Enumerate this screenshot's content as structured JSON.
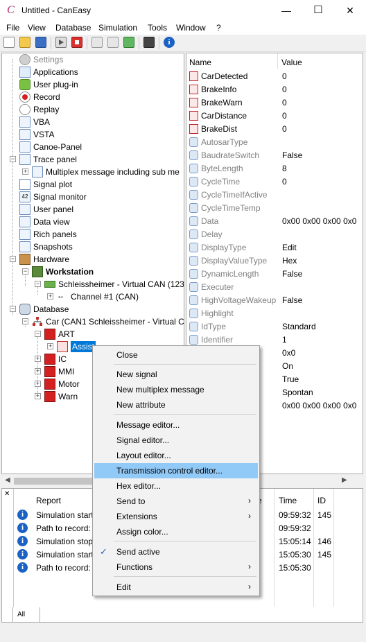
{
  "window": {
    "title": "Untitled - CanEasy",
    "minimize": "—",
    "maximize": "☐",
    "close": "✕"
  },
  "menubar": [
    "File",
    "View",
    "Database",
    "Simulation",
    "Tools",
    "Window",
    "?"
  ],
  "tree": {
    "settings": "Settings",
    "applications": "Applications",
    "user_plugin": "User plug-in",
    "record": "Record",
    "replay": "Replay",
    "vba": "VBA",
    "vsta": "VSTA",
    "canoe_panel": "Canoe-Panel",
    "trace_panel": "Trace panel",
    "multiplex": "Multiplex message including sub me",
    "signal_plot": "Signal plot",
    "signal_monitor": "Signal monitor",
    "user_panel": "User panel",
    "data_view": "Data view",
    "rich_panels": "Rich panels",
    "snapshots": "Snapshots",
    "hardware": "Hardware",
    "workstation": "Workstation",
    "virtual_can": "Schleissheimer - Virtual CAN (123",
    "channel": "Channel #1 (CAN)",
    "database": "Database",
    "car": "Car (CAN1 Schleissheimer - Virtual C",
    "art": "ART",
    "assist": "Assist",
    "ic": "IC",
    "mmi": "MMI",
    "motor": "Motor",
    "warn": "Warn"
  },
  "properties": {
    "header_name": "Name",
    "header_value": "Value",
    "rows": [
      {
        "name": "CarDetected",
        "value": "0",
        "kind": "signal"
      },
      {
        "name": "BrakeInfo",
        "value": "0",
        "kind": "signal"
      },
      {
        "name": "BrakeWarn",
        "value": "0",
        "kind": "signal"
      },
      {
        "name": "CarDistance",
        "value": "0",
        "kind": "signal"
      },
      {
        "name": "BrakeDist",
        "value": "0",
        "kind": "signal"
      },
      {
        "name": "AutosarType",
        "value": "",
        "kind": "attr-gray"
      },
      {
        "name": "BaudrateSwitch",
        "value": "False",
        "kind": "attr"
      },
      {
        "name": "ByteLength",
        "value": "8",
        "kind": "attr"
      },
      {
        "name": "CycleTime",
        "value": "0",
        "kind": "attr"
      },
      {
        "name": "CycleTimeIfActive",
        "value": "",
        "kind": "attr-gray"
      },
      {
        "name": "CycleTimeTemp",
        "value": "",
        "kind": "attr-gray"
      },
      {
        "name": "Data",
        "value": "0x00 0x00 0x00 0x0",
        "kind": "attr"
      },
      {
        "name": "Delay",
        "value": "",
        "kind": "attr-gray"
      },
      {
        "name": "DisplayType",
        "value": "Edit",
        "kind": "attr"
      },
      {
        "name": "DisplayValueType",
        "value": "Hex",
        "kind": "attr"
      },
      {
        "name": "DynamicLength",
        "value": "False",
        "kind": "attr"
      },
      {
        "name": "Executer",
        "value": "",
        "kind": "attr-gray"
      },
      {
        "name": "HighVoltageWakeup",
        "value": "False",
        "kind": "attr"
      },
      {
        "name": "Highlight",
        "value": "",
        "kind": "attr-gray"
      },
      {
        "name": "IdType",
        "value": "Standard",
        "kind": "attr"
      },
      {
        "name": "Identifier",
        "value": "1",
        "kind": "attr"
      },
      {
        "name": "",
        "value": "0x0",
        "kind": "hidden"
      },
      {
        "name": "e",
        "value": "On",
        "kind": "partial"
      },
      {
        "name": "ive",
        "value": "True",
        "kind": "partial"
      },
      {
        "name": "de",
        "value": "Spontan",
        "kind": "partial"
      },
      {
        "name": "",
        "value": "0x00 0x00 0x00 0x0",
        "kind": "hidden"
      }
    ]
  },
  "log": {
    "headers": {
      "report": "Report",
      "source": "ce",
      "time": "Time",
      "id": "ID"
    },
    "rows": [
      {
        "report": "Simulation start",
        "time": "09:59:32",
        "id": "145"
      },
      {
        "report": "Path to record:",
        "time": "09:59:32",
        "id": ""
      },
      {
        "report": "Simulation stop",
        "time": "15:05:14",
        "id": "146"
      },
      {
        "report": "Simulation start",
        "time": "15:05:30",
        "id": "145"
      },
      {
        "report": "Path to record:",
        "time": "15:05:30",
        "id": ""
      }
    ],
    "tab": "All"
  },
  "context_menu": {
    "close": "Close",
    "new_signal": "New signal",
    "new_multiplex": "New multiplex message",
    "new_attribute": "New attribute",
    "message_editor": "Message editor...",
    "signal_editor": "Signal editor...",
    "layout_editor": "Layout editor...",
    "tx_control_editor": "Transmission control editor...",
    "hex_editor": "Hex editor...",
    "send_to": "Send to",
    "extensions": "Extensions",
    "assign_color": "Assign color...",
    "send_active": "Send active",
    "functions": "Functions",
    "edit": "Edit",
    "check": "✓"
  },
  "colors": {
    "accent_highlight": "#91c9f7",
    "selection": "#0078d7",
    "signal_red": "#c0202a",
    "info_blue": "#1b62c4"
  }
}
